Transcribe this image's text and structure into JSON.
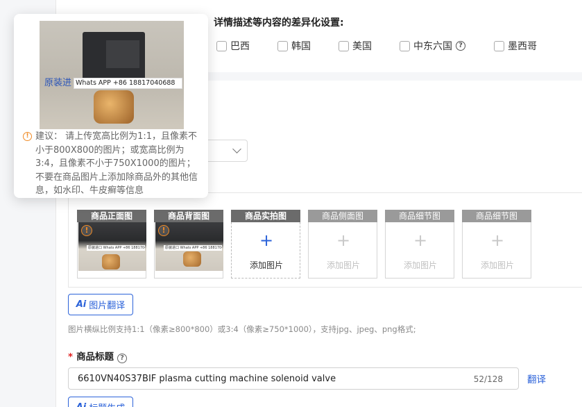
{
  "diff_settings": {
    "title": "详情描述等内容的差异化设置:",
    "countries": [
      {
        "label": "巴西",
        "checked": false
      },
      {
        "label": "韩国",
        "checked": false
      },
      {
        "label": "美国",
        "checked": false
      },
      {
        "label": "中东六国",
        "checked": false,
        "help_icon": "question-circle-icon"
      },
      {
        "label": "墨西哥",
        "checked": false
      }
    ]
  },
  "popover": {
    "watermark_cn": "原装进",
    "watermark_en": "Whats APP +86 18817040688",
    "tip": "建议： 请上传宽高比例为1:1，且像素不小于800X800的图片；或宽高比例为3:4，且像素不小于750X1000的图片；不要在商品图片上添加除商品外的其他信息，如水印、牛皮癣等信息",
    "icon": "warning-circle-icon"
  },
  "image_slots": [
    {
      "label": "商品正面图",
      "state": "filled",
      "warning": true,
      "thumb_watermark": "原装进口 Whats APP +86 18817040688"
    },
    {
      "label": "商品背面图",
      "state": "filled",
      "warning": true,
      "thumb_watermark": "原装进口 Whats APP +86 18817040688"
    },
    {
      "label": "商品实拍图",
      "state": "add",
      "add_text": "添加图片"
    },
    {
      "label": "商品侧面图",
      "state": "disabled",
      "add_text": "添加图片"
    },
    {
      "label": "商品细节图",
      "state": "disabled",
      "add_text": "添加图片"
    },
    {
      "label": "商品细节图",
      "state": "disabled",
      "add_text": "添加图片"
    }
  ],
  "image_translate_button": {
    "ai_mark": "Ai",
    "label": "图片翻译"
  },
  "image_hint": "图片横纵比例支持1:1（像素≥800*800）或3:4（像素≥750*1000），支持jpg、jpeg、png格式;",
  "product_title": {
    "required_mark": "*",
    "label": "商品标题",
    "value": "6610VN40S37BIF plasma cutting machine solenoid valve",
    "counter": "52/128",
    "translate_link": "翻译",
    "generate_button": {
      "ai_mark": "Ai",
      "label": "标题生成"
    }
  },
  "colors": {
    "primary": "#2b62d9",
    "warning": "#f08a24",
    "required": "#e02020",
    "slot_header": "#6b6b6b"
  }
}
